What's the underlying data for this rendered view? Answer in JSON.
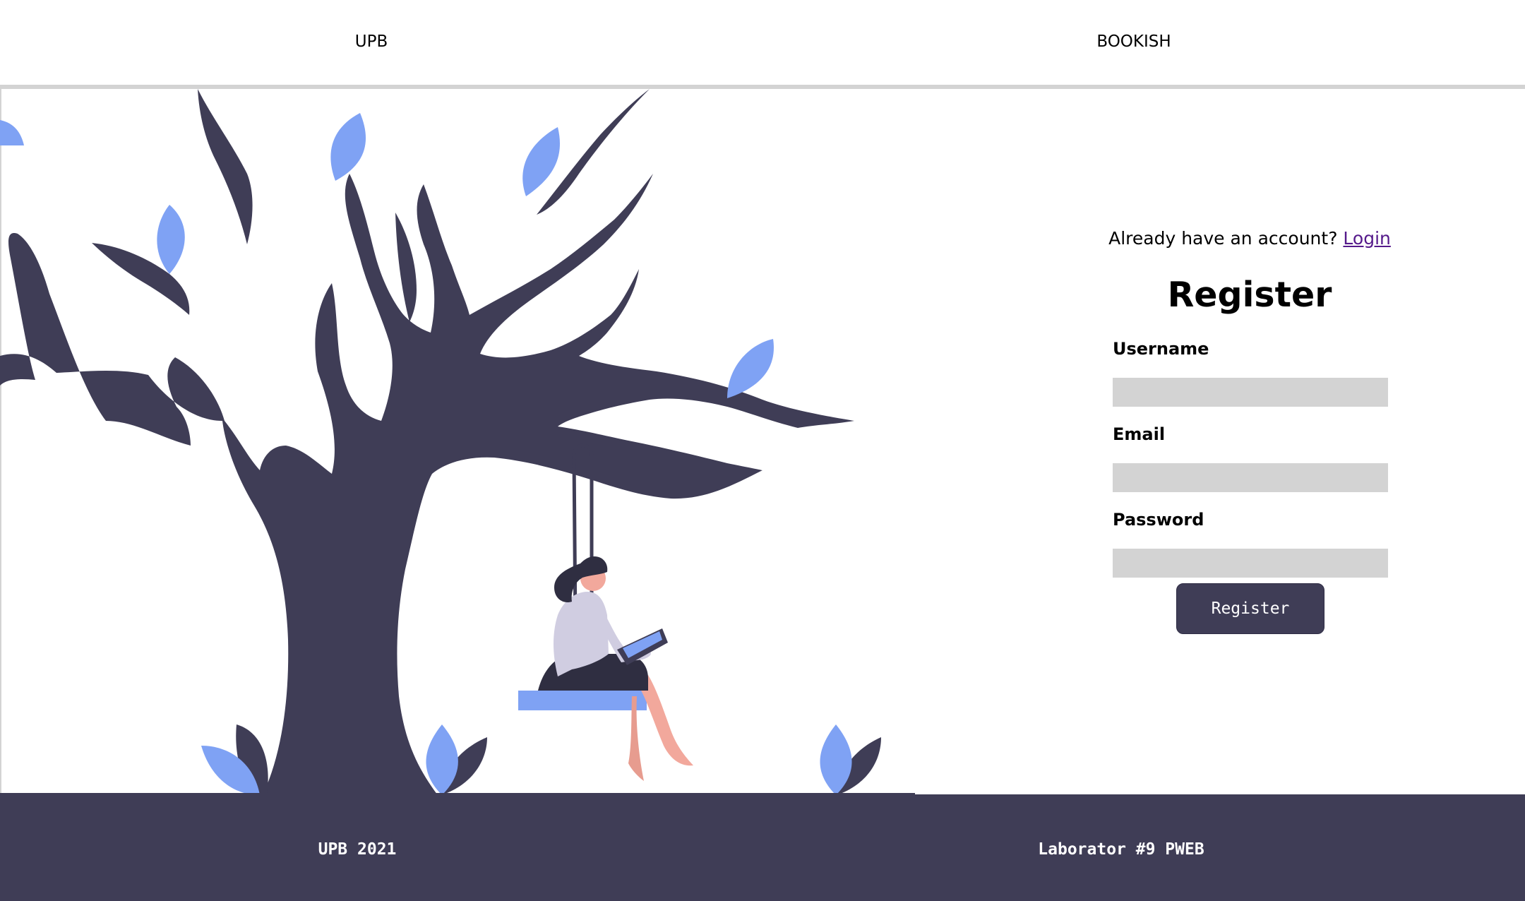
{
  "header": {
    "left_text": "UPB",
    "right_text": "BOOKISH"
  },
  "form": {
    "account_prompt": "Already have an account?",
    "login_link": "Login",
    "title": "Register",
    "fields": [
      {
        "label": "Username",
        "value": ""
      },
      {
        "label": "Email",
        "value": ""
      },
      {
        "label": "Password",
        "value": ""
      }
    ],
    "submit_label": "Register"
  },
  "footer": {
    "left_text": "UPB 2021",
    "right_text": "Laborator #9 PWEB"
  },
  "colors": {
    "accent_dark": "#3f3d56",
    "leaf_blue": "#7fa2f4",
    "input_gray": "#d3d3d3",
    "link_purple": "#551a8b"
  },
  "icons": {
    "illustration": "woman-reading-on-tree-swing"
  }
}
